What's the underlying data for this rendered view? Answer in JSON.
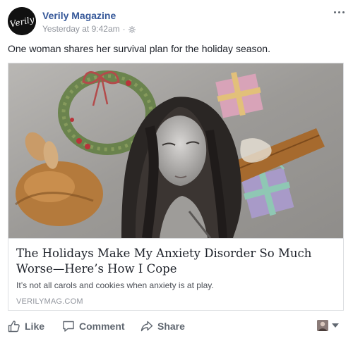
{
  "post": {
    "page_name": "Verily Magazine",
    "timestamp": "Yesterday at 9:42am",
    "separator": "·",
    "avatar_text": "Verily",
    "text": "One woman shares her survival plan for the holiday season."
  },
  "link_card": {
    "title": "The Holidays Make My Anxiety Disorder So Much Worse—Here’s How I Cope",
    "description": "It’s not all carols and cookies when anxiety is at play.",
    "domain": "VERILYMAG.COM"
  },
  "actions": {
    "like_label": "Like",
    "comment_label": "Comment",
    "share_label": "Share"
  },
  "colors": {
    "link_blue": "#365899",
    "meta_gray": "#90949c",
    "action_gray": "#606770",
    "border": "#dddfe2"
  },
  "icons": {
    "audience": "globe-icon",
    "more": "more-icon",
    "like": "thumbs-up-icon",
    "comment": "comment-bubble-icon",
    "share": "share-arrow-icon",
    "menu": "caret-down-icon"
  }
}
